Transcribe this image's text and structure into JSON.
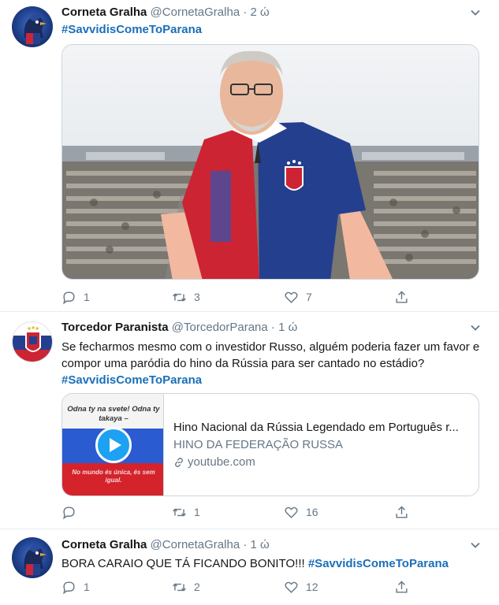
{
  "tweets": [
    {
      "name": "Corneta Gralha",
      "handle": "@CornetaGralha",
      "time": "2 ώ",
      "hashtag": "#SavvidisComeToParana",
      "replies": "1",
      "retweets": "3",
      "likes": "7"
    },
    {
      "name": "Torcedor Paranista",
      "handle": "@TorcedorParana",
      "time": "1 ώ",
      "text": "Se fecharmos mesmo com o investidor Russo, alguém poderia fazer um favor e compor uma paródia do hino da Rússia para ser cantado no estádio?",
      "hashtag": "#SavvidisComeToParana",
      "card": {
        "title": "Hino Nacional da Rússia Legendado em Português r...",
        "description": "HINO DA FEDERAÇÃO RUSSA",
        "domain": "youtube.com",
        "thumb_top": "Odna ty na svete! Odna ty takaya –",
        "thumb_bottom": "No mundo és única, és sem igual."
      },
      "replies": "",
      "retweets": "1",
      "likes": "16"
    },
    {
      "name": "Corneta Gralha",
      "handle": "@CornetaGralha",
      "time": "1 ώ",
      "text": "BORA CARAIO QUE TÁ FICANDO BONITO!!!",
      "hashtag": "#SavvidisComeToParana",
      "replies": "1",
      "retweets": "2",
      "likes": "12"
    }
  ],
  "colors": {
    "link": "#1b6fb8",
    "muted": "#657786",
    "text": "#14171a",
    "divider": "#e6ecf0",
    "shirt_red": "#cc2433",
    "shirt_blue": "#253f8f"
  },
  "icons": [
    "crow-avatar",
    "crest-avatar",
    "chevron-down-icon",
    "reply-icon",
    "retweet-icon",
    "like-icon",
    "share-icon",
    "play-icon",
    "link-icon"
  ]
}
